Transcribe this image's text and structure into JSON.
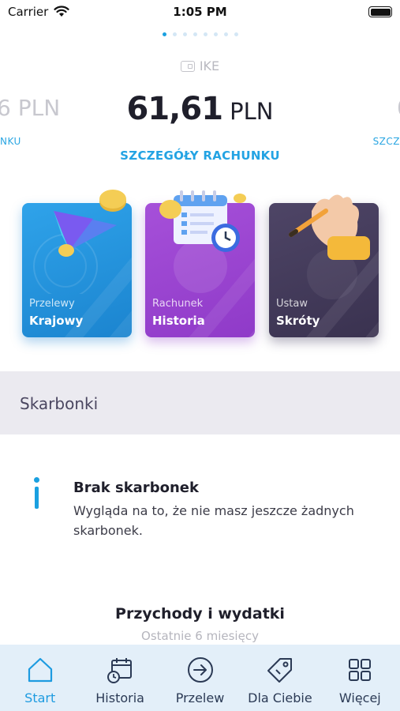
{
  "status_bar": {
    "carrier": "Carrier",
    "time": "1:05 PM"
  },
  "pager": {
    "count": 8,
    "active_index": 0
  },
  "account": {
    "type_label": "IKE",
    "balance_amount": "61,61",
    "balance_currency": "PLN",
    "prev_balance_partial": "6 PLN",
    "prev_label_partial": "NKU",
    "next_balance_partial": "0",
    "next_label_partial": "SZCZ",
    "details_link": "SZCZEGÓŁY RACHUNKU"
  },
  "tiles": [
    {
      "subtitle": "Przelewy",
      "title": "Krajowy",
      "theme": "blue"
    },
    {
      "subtitle": "Rachunek",
      "title": "Historia",
      "theme": "purple"
    },
    {
      "subtitle": "Ustaw",
      "title": "Skróty",
      "theme": "dark"
    }
  ],
  "savings": {
    "section_title": "Skarbonki",
    "empty_title": "Brak skarbonek",
    "empty_text": "Wygląda na to, że nie masz jeszcze żadnych skarbonek."
  },
  "income_expenses": {
    "title": "Przychody i wydatki",
    "subtitle": "Ostatnie 6 miesięcy"
  },
  "tab_bar": {
    "items": [
      {
        "label": "Start",
        "icon": "home-icon",
        "active": true
      },
      {
        "label": "Historia",
        "icon": "calendar-history-icon",
        "active": false
      },
      {
        "label": "Przelew",
        "icon": "arrow-circle-icon",
        "active": false
      },
      {
        "label": "Dla Ciebie",
        "icon": "tag-icon",
        "active": false
      },
      {
        "label": "Więcej",
        "icon": "grid-icon",
        "active": false
      }
    ]
  },
  "colors": {
    "accent": "#1aa0e0",
    "tile_blue": "#2a9de6",
    "tile_purple": "#9b45d0",
    "tile_dark": "#463d5e",
    "tab_bar_bg": "#e3eff9"
  }
}
